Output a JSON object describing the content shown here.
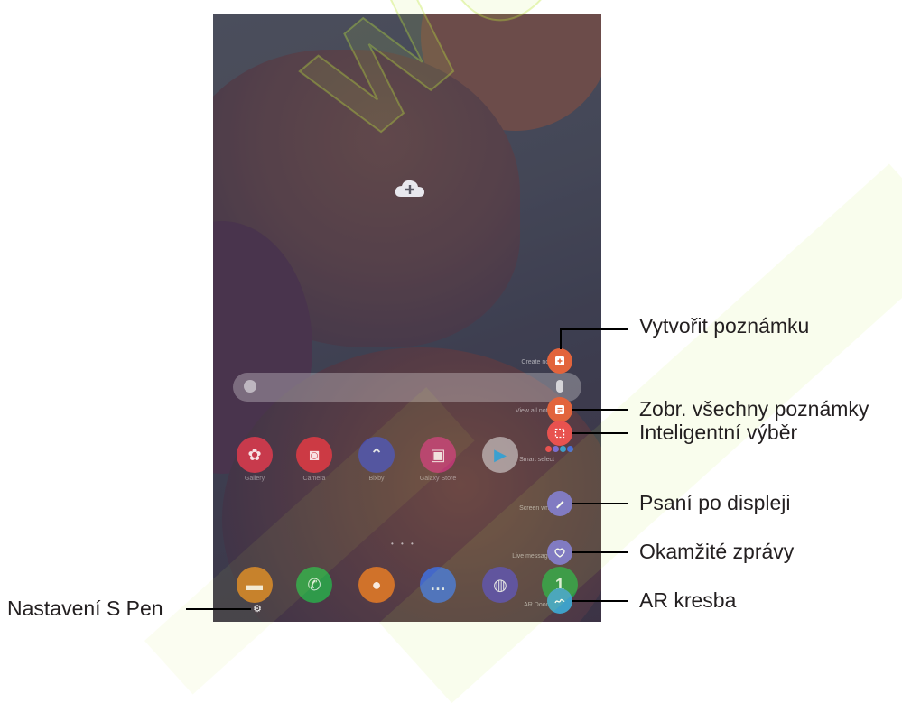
{
  "callouts": {
    "create_note": "Vytvořit poznámku",
    "view_all_notes": "Zobr. všechny poznámky",
    "smart_select": "Inteligentní výběr",
    "screen_write": "Psaní po displeji",
    "live_messages": "Okamžité zprávy",
    "ar_doodle": "AR kresba",
    "s_pen_settings": "Nastavení S Pen"
  },
  "watermark": "WORLD",
  "air_command": {
    "items": [
      {
        "label": "Create note",
        "icon": "note-plus-icon",
        "color": "#e2643c"
      },
      {
        "label": "View all notes",
        "icon": "notes-icon",
        "color": "#e2643c"
      },
      {
        "label": "Smart select",
        "icon": "smart-select-icon",
        "color": "#e8524f"
      },
      {
        "label": "Screen write",
        "icon": "pen-write-icon",
        "color": "#7a6fd0"
      },
      {
        "label": "Live messages",
        "icon": "heart-icon",
        "color": "#7a6fd0"
      },
      {
        "label": "AR Doodle",
        "icon": "ar-doodle-icon",
        "color": "#3fa0c8"
      }
    ]
  },
  "apps": {
    "row1": [
      {
        "label": "Gallery",
        "icon": "gallery-icon",
        "color": "#d63a4a"
      },
      {
        "label": "Camera",
        "icon": "camera-icon",
        "color": "#d83a44"
      },
      {
        "label": "Bixby",
        "icon": "bixby-icon",
        "color": "#4f4fb0"
      },
      {
        "label": "Galaxy Store",
        "icon": "store-icon",
        "color": "#c93a7a"
      },
      {
        "label": "Play Store",
        "icon": "play-store-icon",
        "color": "#eeeeee"
      }
    ],
    "dock": [
      {
        "label": "",
        "icon": "files-icon",
        "color": "#e08a2a"
      },
      {
        "label": "",
        "icon": "phone-icon",
        "color": "#2fa44f"
      },
      {
        "label": "",
        "icon": "contacts-icon",
        "color": "#e27a2a"
      },
      {
        "label": "",
        "icon": "messages-icon",
        "color": "#4a6fd8"
      },
      {
        "label": "",
        "icon": "internet-icon",
        "color": "#5a4ab0"
      },
      {
        "label": "",
        "icon": "calendar-icon",
        "color": "#3aa04f"
      }
    ]
  },
  "colors": {
    "accent_orange": "#e2643c",
    "accent_purple": "#7a6fd0",
    "accent_blue": "#3fa0c8"
  }
}
